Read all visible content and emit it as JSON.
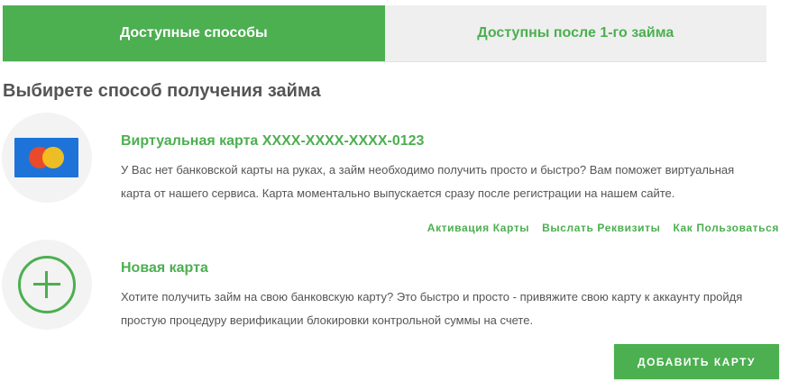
{
  "tabs": [
    {
      "label": "Доступные способы",
      "active": true
    },
    {
      "label": "Доступны после 1-го займа",
      "active": false
    }
  ],
  "heading": "Выбирете способ получения займа",
  "items": [
    {
      "icon": "bank-card-icon",
      "title": "Виртуальная карта XXXX-XXXX-XXXX-0123",
      "line1": "У Вас нет банковской карты на руках, а займ необходимо получить просто и быстро? Вам поможет виртуальная",
      "line2": "карта от нашего сервиса. Карта моментально выпускается сразу после регистрации на нашем сайте.",
      "links": [
        "Активация Карты",
        "Выслать Реквизиты",
        "Как Пользоваться"
      ]
    },
    {
      "icon": "plus-circle-icon",
      "title": "Новая карта",
      "line1": "Хотите получить займ на свою банковскую карту? Это быстро и просто - привяжите свою карту к аккаунту пройдя",
      "line2": "простую процедуру верификации блокировки контрольной суммы на счете."
    }
  ],
  "add_button_label": "ДОБАВИТЬ КАРТУ",
  "colors": {
    "accent": "#4caf50",
    "tab_inactive_bg": "#efefef",
    "text": "#555555"
  }
}
